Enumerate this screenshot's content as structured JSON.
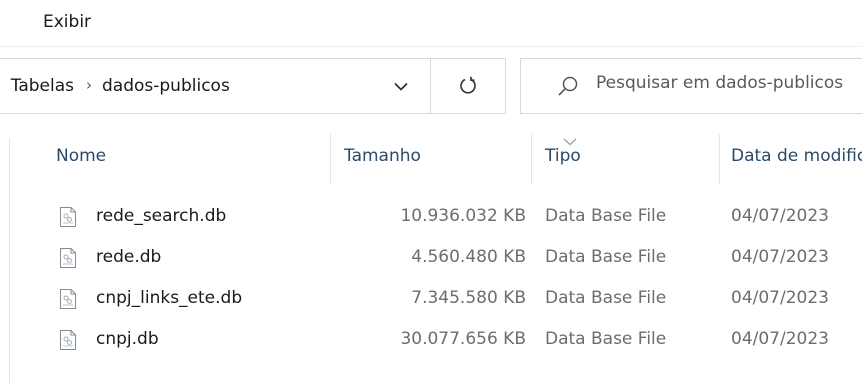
{
  "menubar": {
    "view_label": "Exibir"
  },
  "address": {
    "parent_crumb": "Tabelas",
    "current_crumb": "dados-publicos",
    "separator": "›"
  },
  "search": {
    "placeholder": "Pesquisar em dados-publicos"
  },
  "columns": {
    "name": "Nome",
    "size": "Tamanho",
    "type": "Tipo",
    "date": "Data de modificação"
  },
  "files": [
    {
      "name": "rede_search.db",
      "size": "10.936.032 KB",
      "type": "Data Base File",
      "date": "04/07/2023"
    },
    {
      "name": "rede.db",
      "size": "4.560.480 KB",
      "type": "Data Base File",
      "date": "04/07/2023"
    },
    {
      "name": "cnpj_links_ete.db",
      "size": "7.345.580 KB",
      "type": "Data Base File",
      "date": "04/07/2023"
    },
    {
      "name": "cnpj.db",
      "size": "30.077.656 KB",
      "type": "Data Base File",
      "date": "04/07/2023"
    }
  ],
  "icons": {
    "dropdown": "chevron-down-icon",
    "refresh": "refresh-icon",
    "search": "search-icon",
    "sort": "sort-chevron-icon",
    "file": "file-icon"
  },
  "colors": {
    "header_text": "#2a4a6a",
    "secondary_text": "#6d6d6d",
    "border": "#d9d9d9"
  }
}
